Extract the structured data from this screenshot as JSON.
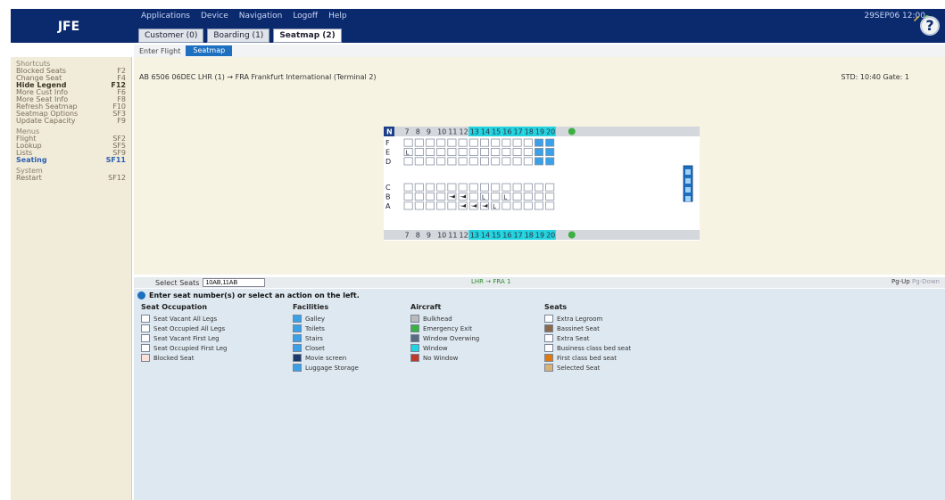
{
  "app": {
    "logo": "JFE",
    "status": "29SEP06 12:00"
  },
  "menu": [
    "Applications",
    "Device",
    "Navigation",
    "Logoff",
    "Help"
  ],
  "tabs": [
    {
      "label": "Customer (0)"
    },
    {
      "label": "Boarding (1)"
    },
    {
      "label": "Seatmap (2)"
    }
  ],
  "breadcrumb": {
    "first": "Enter Flight",
    "current": "Seatmap"
  },
  "sidebar": {
    "sections": [
      {
        "title": "Shortcuts",
        "items": [
          {
            "label": "Blocked Seats",
            "key": "F2"
          },
          {
            "label": "Change Seat",
            "key": "F4"
          },
          {
            "label": "Hide Legend",
            "key": "F12",
            "style": "bold"
          },
          {
            "label": "More Cust Info",
            "key": "F6"
          },
          {
            "label": "More Seat Info",
            "key": "F8"
          },
          {
            "label": "Refresh Seatmap",
            "key": "F10"
          },
          {
            "label": "Seatmap Options",
            "key": "SF3"
          },
          {
            "label": "Update Capacity",
            "key": "F9"
          }
        ]
      },
      {
        "title": "Menus",
        "items": [
          {
            "label": "Flight",
            "key": "SF2"
          },
          {
            "label": "Lookup",
            "key": "SF5"
          },
          {
            "label": "Lists",
            "key": "SF9"
          },
          {
            "label": "Seating",
            "key": "SF11",
            "style": "sel"
          }
        ]
      },
      {
        "title": "System",
        "items": [
          {
            "label": "Restart",
            "key": "SF12"
          }
        ]
      }
    ]
  },
  "flight": {
    "info": "AB 6506  06DEC LHR (1) → FRA Frankfurt International (Terminal 2)",
    "std": "STD: 10:40 Gate: 1"
  },
  "seatmap": {
    "row_labels": [
      "F",
      "E",
      "D",
      "C",
      "B",
      "A"
    ],
    "columns": [
      "7",
      "8",
      "9",
      "10",
      "11",
      "12",
      "13",
      "14",
      "15",
      "16",
      "17",
      "18",
      "19",
      "20"
    ],
    "highlight_columns": [
      "13",
      "14",
      "15",
      "16",
      "17",
      "18",
      "19",
      "20"
    ]
  },
  "select": {
    "label": "Select Seats",
    "value": "10AB,11AB",
    "route": "LHR → FRA 1",
    "pgup": "Pg-Up",
    "pgdown": "Pg-Down"
  },
  "legend": {
    "prompt": "Enter seat number(s) or select an action on the left.",
    "columns": [
      {
        "title": "Seat Occupation",
        "items": [
          {
            "label": "Seat Vacant All Legs",
            "icon": "seat-vacant-icon"
          },
          {
            "label": "Seat Occupied All Legs",
            "icon": "seat-occupied-icon"
          },
          {
            "label": "Seat Vacant First Leg",
            "icon": "seat-vacant-first-leg-icon"
          },
          {
            "label": "Seat Occupied First Leg",
            "icon": "seat-occupied-first-leg-icon"
          },
          {
            "label": "Blocked Seat",
            "icon": "blocked-seat-icon"
          }
        ]
      },
      {
        "title": "Facilities",
        "items": [
          {
            "label": "Galley",
            "icon": "galley-icon"
          },
          {
            "label": "Toilets",
            "icon": "toilets-icon"
          },
          {
            "label": "Stairs",
            "icon": "stairs-icon"
          },
          {
            "label": "Closet",
            "icon": "closet-icon"
          },
          {
            "label": "Movie screen",
            "icon": "movie-screen-icon"
          },
          {
            "label": "Luggage Storage",
            "icon": "luggage-storage-icon"
          }
        ]
      },
      {
        "title": "Aircraft",
        "items": [
          {
            "label": "Bulkhead",
            "icon": "bulkhead-icon"
          },
          {
            "label": "Emergency Exit",
            "icon": "emergency-exit-icon"
          },
          {
            "label": "Window Overwing",
            "icon": "window-overwing-icon"
          },
          {
            "label": "Window",
            "icon": "window-icon"
          },
          {
            "label": "No Window",
            "icon": "no-window-icon"
          }
        ]
      },
      {
        "title": "Seats",
        "items": [
          {
            "label": "Extra Legroom",
            "icon": "extra-legroom-icon"
          },
          {
            "label": "Bassinet Seat",
            "icon": "bassinet-icon"
          },
          {
            "label": "Extra Seat",
            "icon": "extra-seat-icon"
          },
          {
            "label": "Business class bed seat",
            "icon": "business-bed-icon"
          },
          {
            "label": "First class bed seat",
            "icon": "first-bed-icon"
          },
          {
            "label": "Selected Seat",
            "icon": "selected-seat-icon"
          }
        ]
      }
    ]
  },
  "colors": {
    "header": "#0b2a6e",
    "accent": "#1d6fc0",
    "highlight": "#22d3e0",
    "sidebar": "#f1ebda",
    "panel": "#f6f3e3",
    "legend": "#dde8f0"
  }
}
